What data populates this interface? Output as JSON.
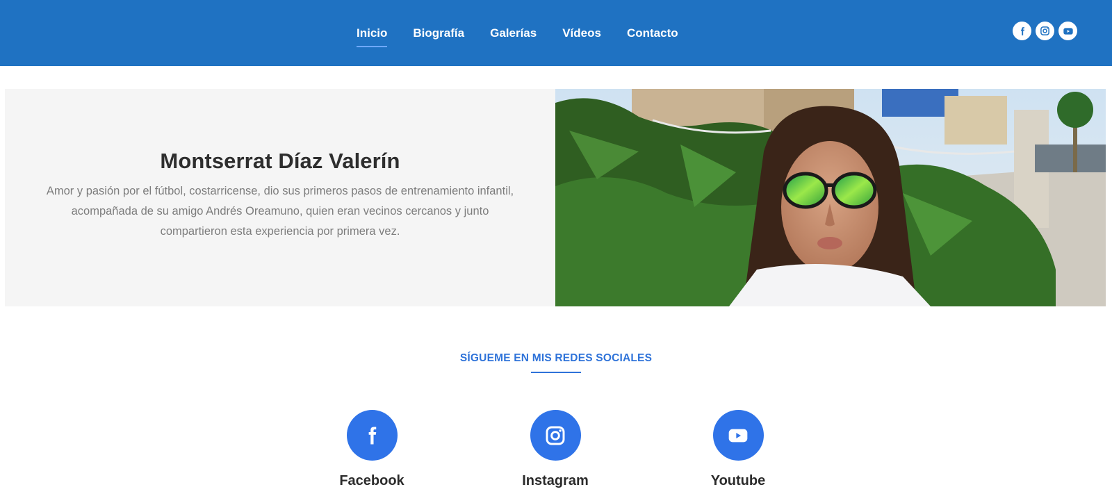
{
  "nav": {
    "items": [
      {
        "label": "Inicio",
        "active": true
      },
      {
        "label": "Biografía",
        "active": false
      },
      {
        "label": "Galerías",
        "active": false
      },
      {
        "label": "Vídeos",
        "active": false
      },
      {
        "label": "Contacto",
        "active": false
      }
    ],
    "social_icons": [
      "facebook-icon",
      "instagram-icon",
      "youtube-icon"
    ]
  },
  "hero": {
    "title": "Montserrat Díaz Valerín",
    "text": "Amor y pasión por el fútbol, costarricense, dio sus primeros pasos de entrenamiento infantil, acompañada de su amigo Andrés Oreamuno, quien eran vecinos cercanos y junto compartieron esta experiencia por primera vez."
  },
  "social": {
    "title": "SÍGUEME EN MIS REDES SOCIALES",
    "cards": [
      {
        "label": "Facebook",
        "icon": "facebook-icon"
      },
      {
        "label": "Instagram",
        "icon": "instagram-icon"
      },
      {
        "label": "Youtube",
        "icon": "youtube-icon"
      }
    ]
  },
  "colors": {
    "header_bg": "#1f72c2",
    "accent": "#2f73e8",
    "hero_panel_bg": "#f5f5f5"
  }
}
